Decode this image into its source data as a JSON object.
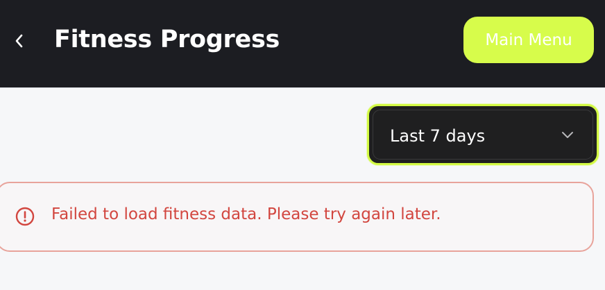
{
  "header": {
    "title": "Fitness Progress",
    "menu_label": "Main Menu",
    "back_icon": "chevron-left-icon"
  },
  "filter": {
    "selected": "Last 7 days",
    "icon": "chevron-down-icon"
  },
  "alert": {
    "message": "Failed to load fitness data. Please try again later.",
    "icon": "alert-circle-icon"
  },
  "colors": {
    "header_bg": "#1c1d22",
    "accent": "#d7fc4b",
    "page_bg": "#f6f7f9",
    "error": "#d2463f",
    "error_border": "#e8a39b",
    "select_bg": "#1f1f20"
  }
}
